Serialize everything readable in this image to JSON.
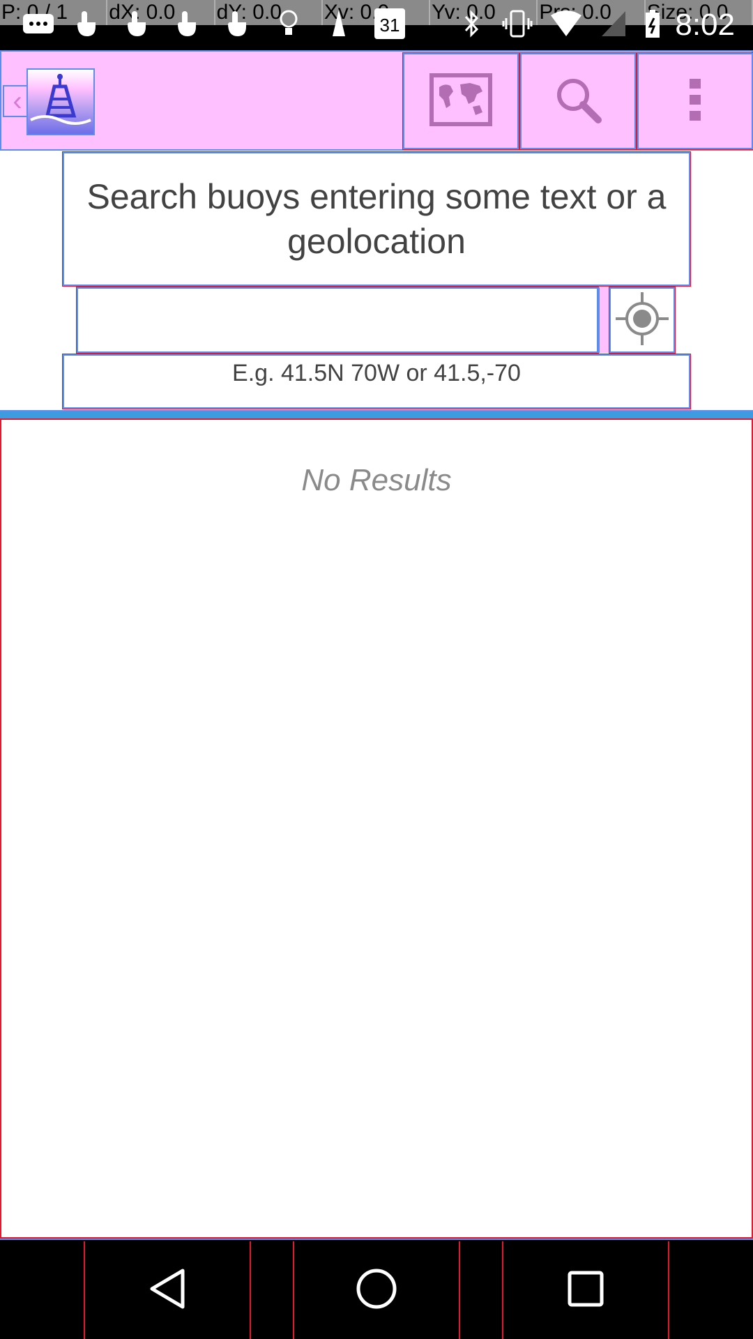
{
  "status_bar": {
    "pointer_overlay": [
      "P: 0 / 1",
      "dX: 0.0",
      "dY: 0.0",
      "Xv: 0.0",
      "Yv: 0.0",
      "Prs: 0.0",
      "Size: 0.0"
    ],
    "time": "8:02",
    "calendar_day": "31",
    "icons": [
      "messages-icon",
      "touch-icon",
      "touch-icon",
      "touch-icon",
      "touch-icon",
      "lightbulb-icon",
      "pawn-icon",
      "calendar-icon",
      "bluetooth-icon",
      "vibrate-icon",
      "wifi-icon",
      "cell-signal-icon",
      "battery-icon"
    ]
  },
  "app_bar": {
    "back_glyph": "‹",
    "actions": [
      "world-map-icon",
      "search-icon",
      "more-vert-icon"
    ]
  },
  "search": {
    "heading": "Search buoys entering some text or a geolocation",
    "input_value": "",
    "hint": "E.g. 41.5N 70W or 41.5,-70"
  },
  "results": {
    "empty_text": "No Results"
  },
  "nav_bar": {
    "buttons": [
      "back-icon",
      "home-icon",
      "recents-icon"
    ]
  },
  "colors": {
    "app_bar_bg": "#ffc0ff",
    "accent_divider": "#3f9be0",
    "layout_bounds_blue": "#5b8df0",
    "layout_bounds_red": "#e0192f"
  }
}
